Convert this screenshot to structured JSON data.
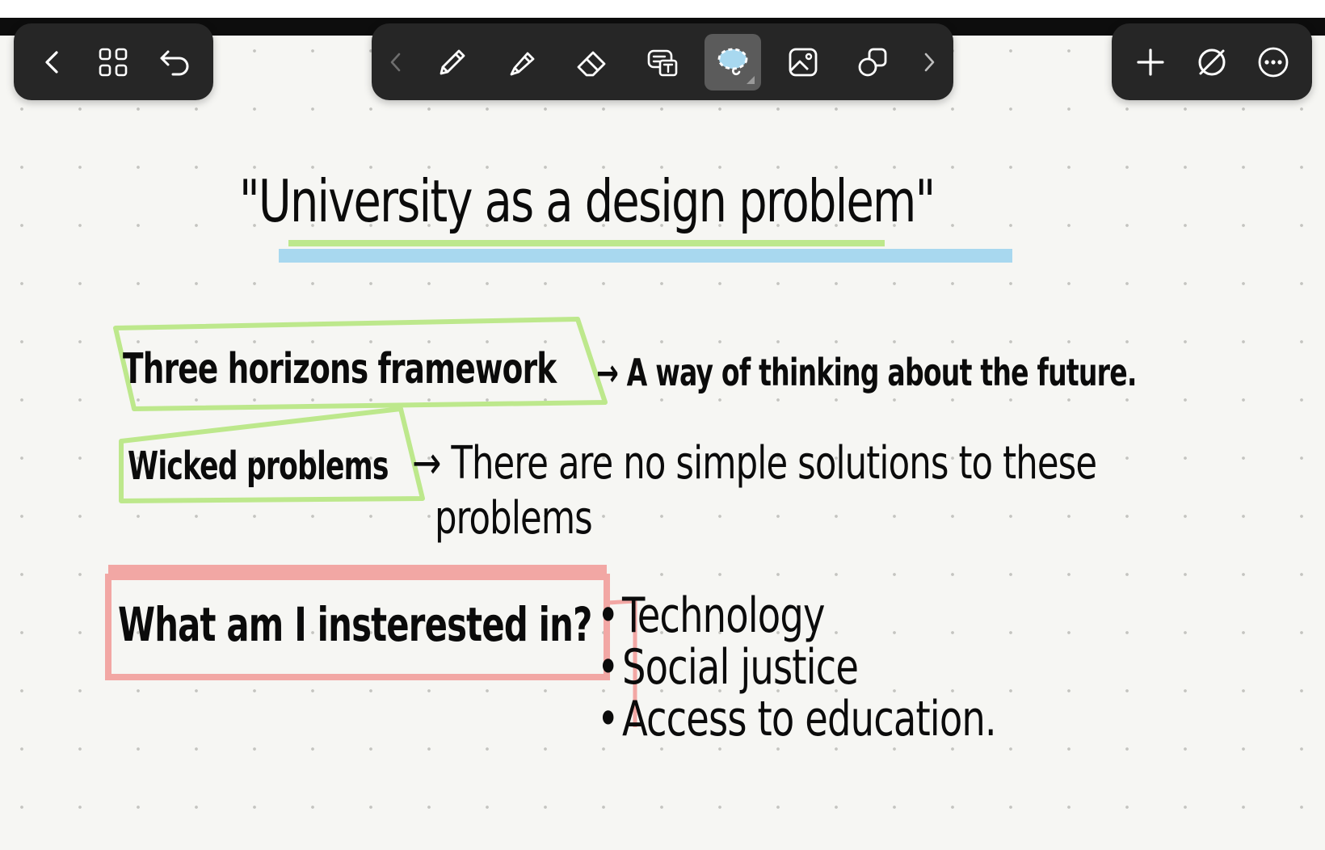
{
  "toolbar_left": {
    "back_icon": "chevron-left-icon",
    "grid_icon": "grid-icon",
    "undo_icon": "undo-icon"
  },
  "toolbar_center": {
    "tools": [
      "chevron-left-icon",
      "pen-icon",
      "highlighter-icon",
      "eraser-icon",
      "text-box-icon",
      "lasso-icon",
      "image-icon",
      "shapes-icon",
      "chevron-right-icon"
    ],
    "active_tool": "lasso-icon",
    "active_color": "#5b5b5b"
  },
  "toolbar_right": {
    "add_icon": "plus-icon",
    "pen-off_icon": "no-pen-icon",
    "more_icon": "more-icon"
  },
  "note": {
    "title": "\"University as a design problem\"",
    "row1_term": "Three horizons framework",
    "row1_def": "→ A way of thinking about the future.",
    "row2_term": "Wicked problems",
    "row2_def": "→ There are no simple solutions to these",
    "row2_def_cont": "problems",
    "row3_question": "What am I insterested in?",
    "interests": [
      "Technology",
      "Social justice",
      "Access to education."
    ]
  },
  "colors": {
    "canvas": "#f6f6f3",
    "highlight_green": "#bde88c",
    "highlight_blue": "#a8d8ef",
    "highlight_red": "#f2a7a4",
    "ink": "#0b0b0b",
    "toolbar": "#262626"
  }
}
